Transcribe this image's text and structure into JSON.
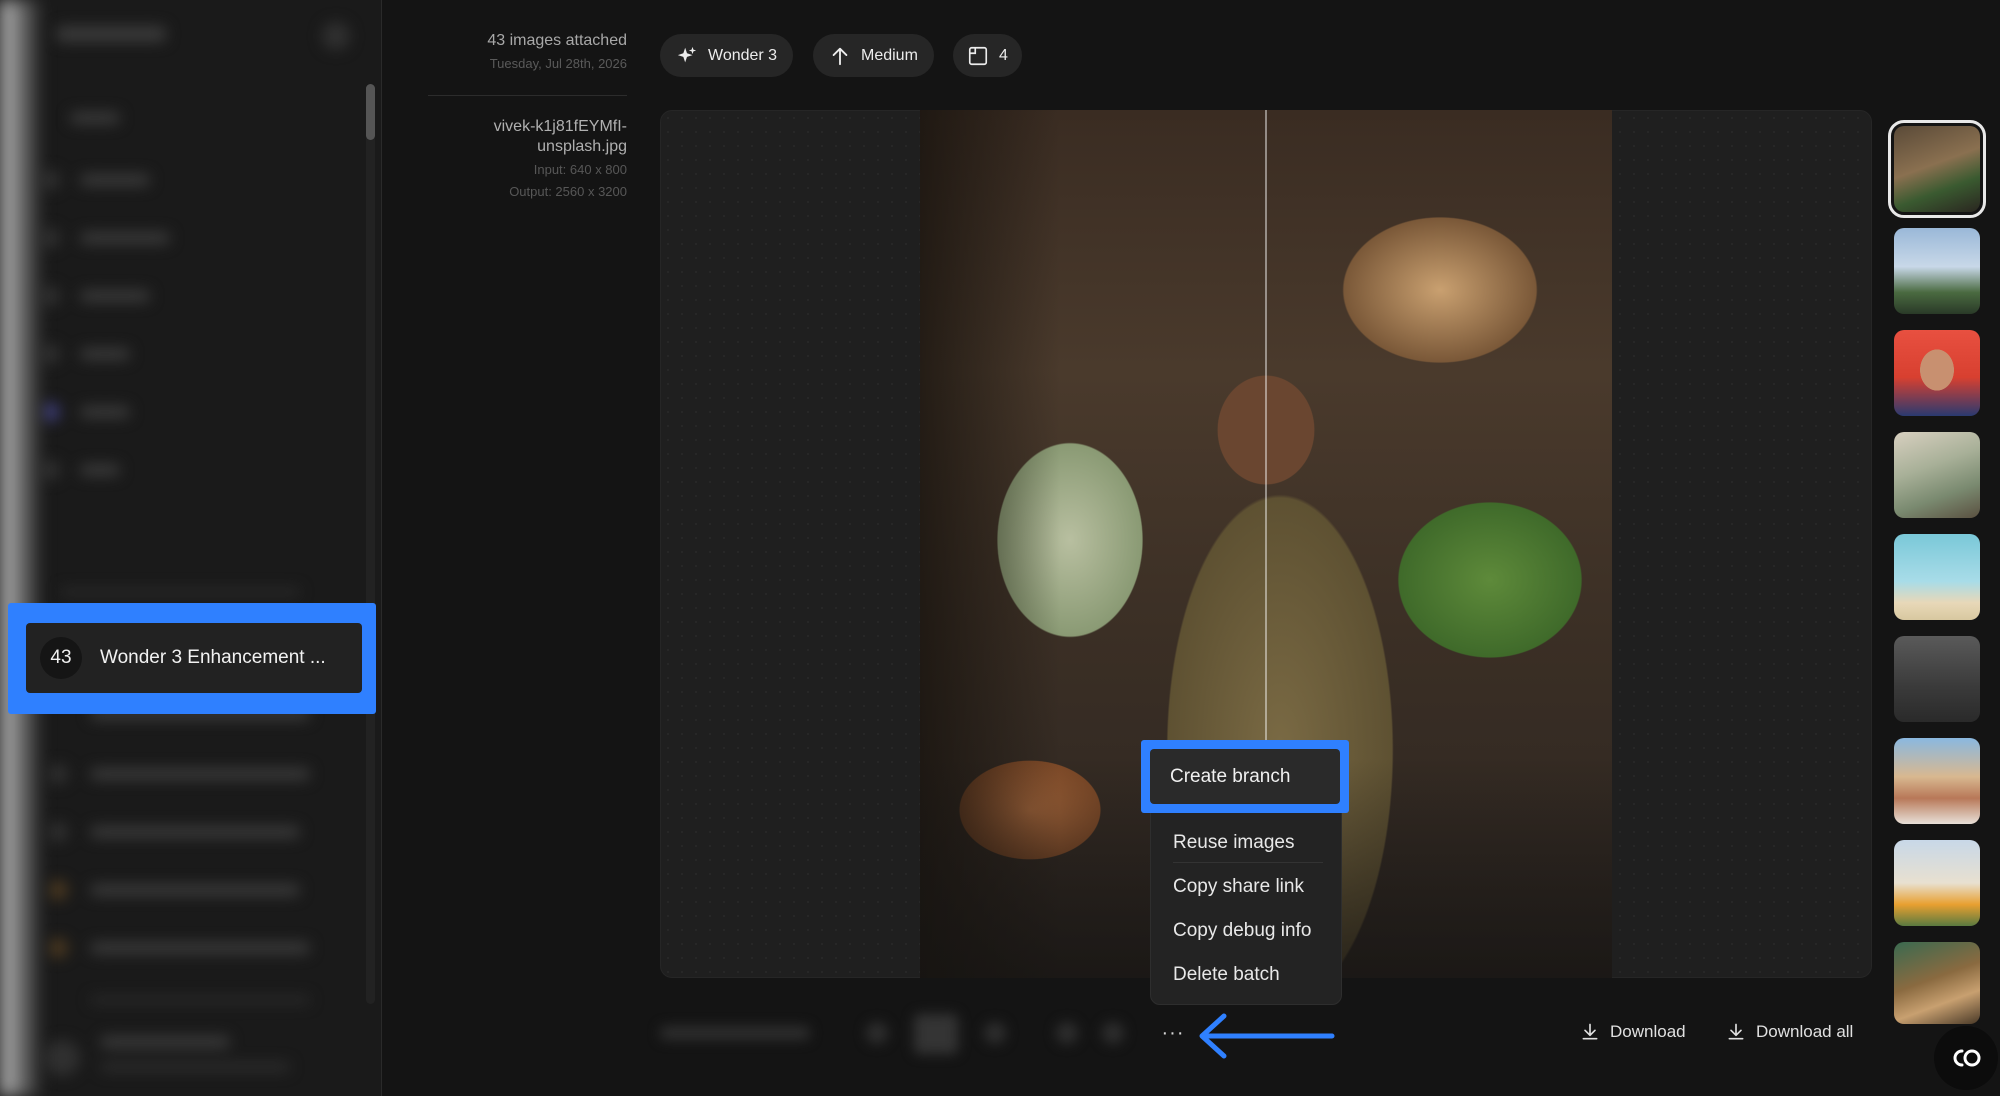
{
  "sidebar": {
    "highlighted_batch": {
      "count": "43",
      "name": "Wonder 3 Enhancement ..."
    }
  },
  "meta": {
    "images_attached": "43 images attached",
    "date": "Tuesday, Jul 28th, 2026",
    "filename": "vivek-k1j81fEYMfI-unsplash.jpg",
    "filename_line1": "vivek-k1j81fEYMfI-",
    "filename_line2": "unsplash.jpg",
    "input": "Input: 640 x 800",
    "output": "Output: 2560 x 3200"
  },
  "chips": {
    "model": {
      "label": "Wonder 3",
      "icon": "sparkle-icon"
    },
    "strength": {
      "label": "Medium",
      "icon": "arrow-up-icon"
    },
    "count": {
      "label": "4",
      "icon": "grid-icon"
    }
  },
  "context_menu": {
    "items": [
      "Create branch",
      "Reuse images",
      "Copy share link",
      "Copy debug info",
      "Delete batch"
    ]
  },
  "bottom_bar": {
    "more_label": "···",
    "download": "Download",
    "download_all": "Download all"
  },
  "colors": {
    "highlight": "#2f80ff",
    "background": "#141414",
    "panel": "#1f1f1f"
  }
}
